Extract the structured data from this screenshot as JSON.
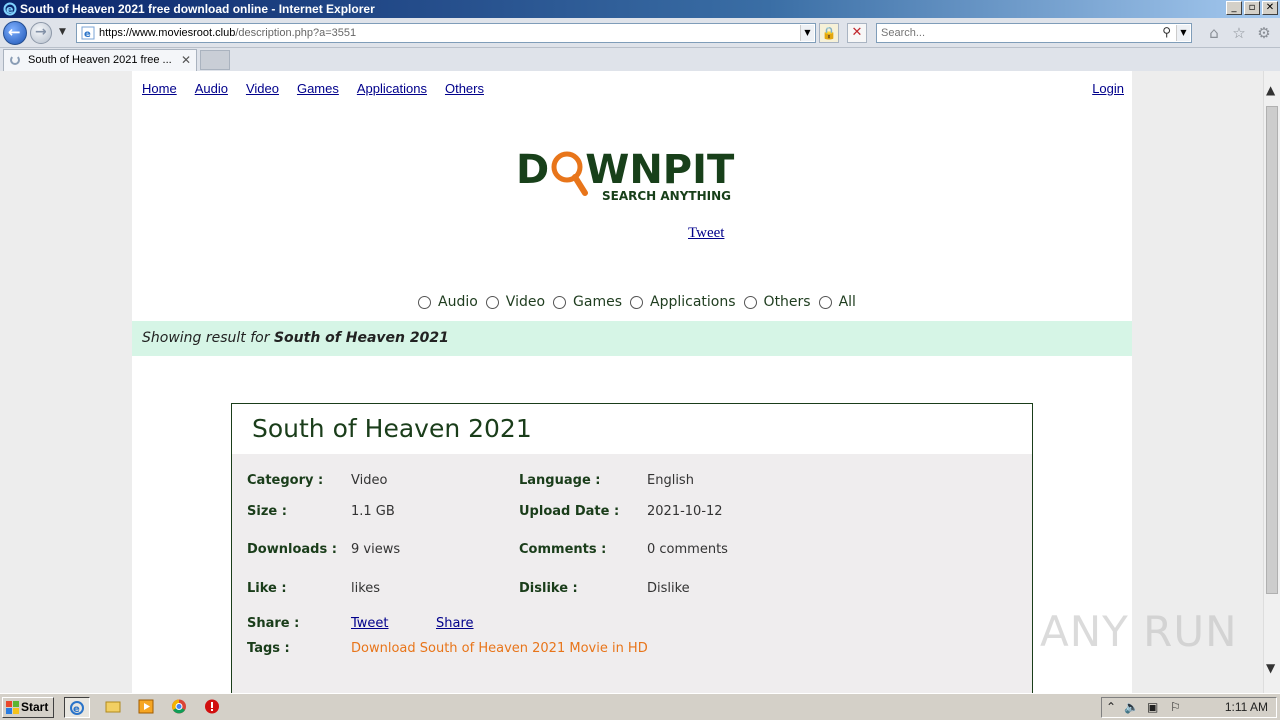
{
  "window": {
    "title": "South of Heaven 2021 free download online - Internet Explorer",
    "buttons": [
      "_",
      "▫",
      "✕"
    ]
  },
  "browser": {
    "url_host": "https://www.moviesroot.club",
    "url_path": "/description.php?a=3551",
    "search_placeholder": "Search...",
    "tab_title": "South of Heaven 2021 free ..."
  },
  "site": {
    "nav": [
      "Home",
      "Audio",
      "Video",
      "Games",
      "Applications",
      "Others"
    ],
    "login": "Login",
    "logo_left": "D",
    "logo_right": "WNPIT",
    "logo_tagline": "SEARCH ANYTHING",
    "tweet": "Tweet",
    "categories": [
      "Audio",
      "Video",
      "Games",
      "Applications",
      "Others",
      "All"
    ],
    "result_prefix": "Showing result for ",
    "result_query": "South of Heaven 2021"
  },
  "item": {
    "title": "South of Heaven 2021",
    "fields": {
      "category_label": "Category :",
      "category_value": "Video",
      "language_label": "Language :",
      "language_value": "English",
      "size_label": "Size :",
      "size_value": "1.1 GB",
      "upload_label": "Upload Date :",
      "upload_value": "2021-10-12",
      "downloads_label": "Downloads :",
      "downloads_value": "9 views",
      "comments_label": "Comments :",
      "comments_value": "0 comments",
      "like_label": "Like :",
      "like_value": "likes",
      "dislike_label": "Dislike :",
      "dislike_value": "Dislike",
      "share_label": "Share :",
      "share_tweet": "Tweet",
      "share_share": "Share",
      "tags_label": "Tags :",
      "tags_value": "Download South of Heaven 2021 Movie in HD"
    }
  },
  "watermark": "ANY RUN",
  "taskbar": {
    "start_label": "Start",
    "clock": "1:11 AM"
  },
  "colors": {
    "brand_green": "#18401a",
    "logo_accent": "#e8751a",
    "result_bar": "#d6f5e6",
    "link": "#00008b"
  }
}
